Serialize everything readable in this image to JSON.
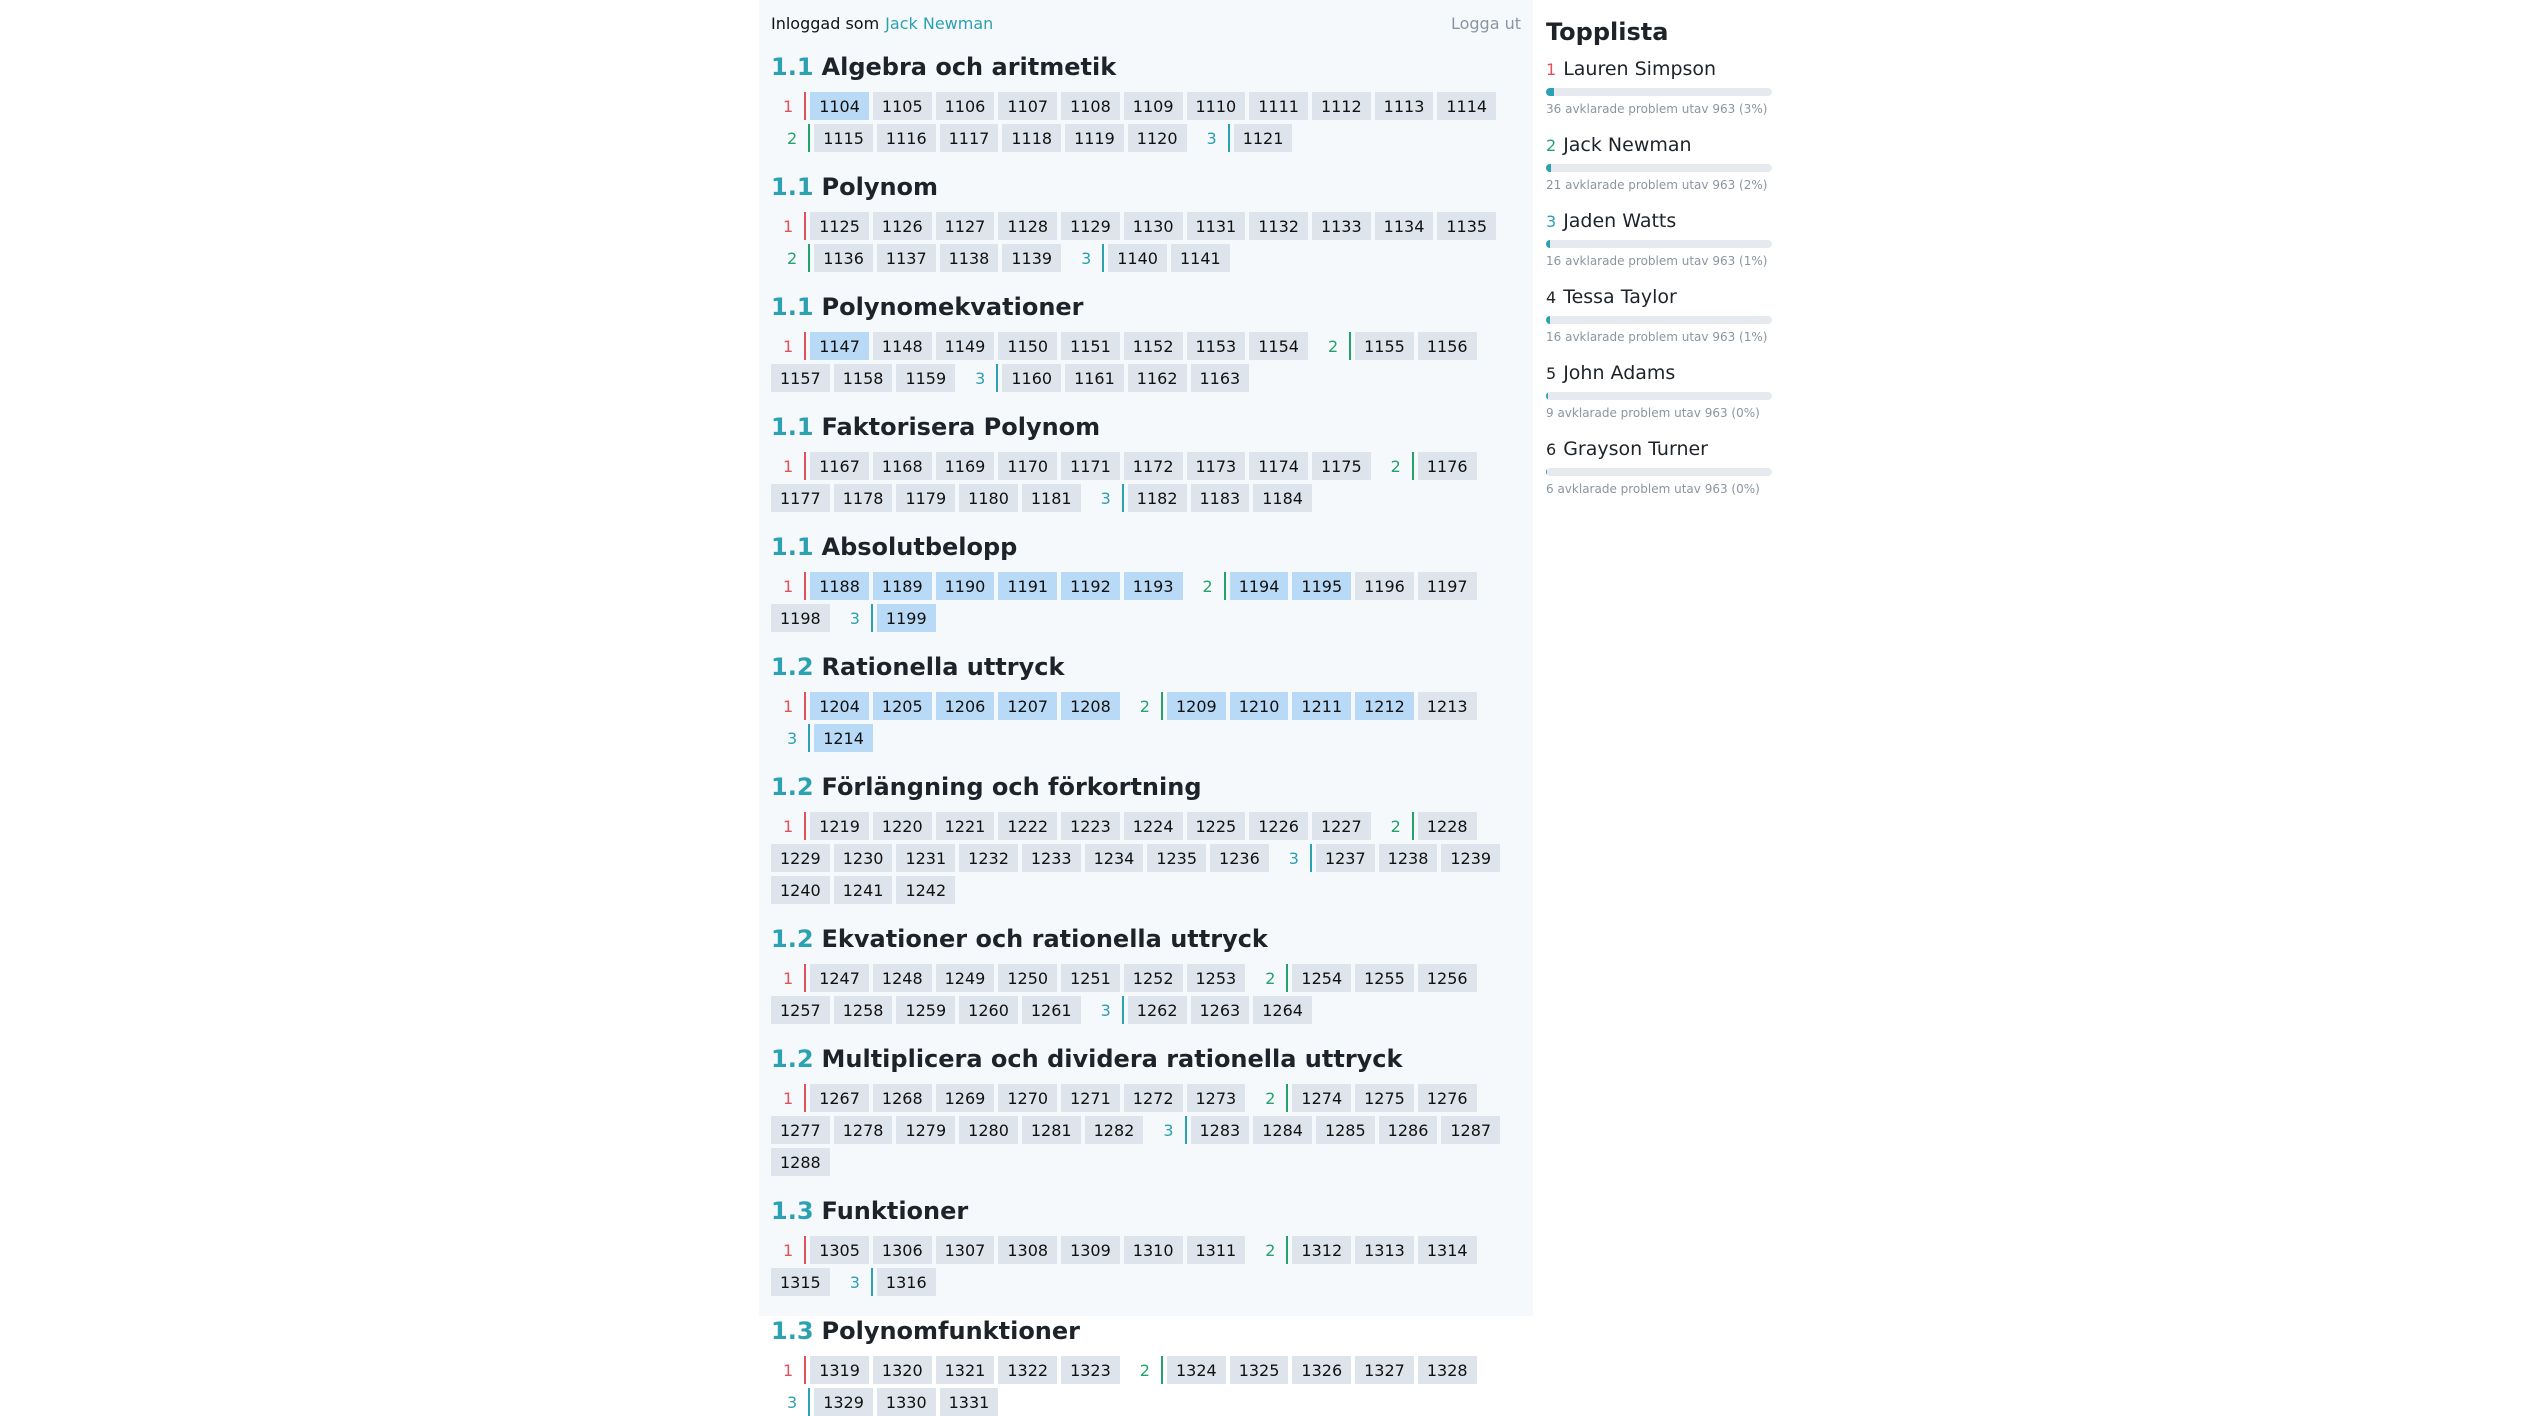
{
  "header": {
    "logged_in_label": "Inloggad som",
    "user_name": "Jack Newman",
    "logout_label": "Logga ut"
  },
  "sections": [
    {
      "number": "1.1",
      "title": "Algebra och aritmetik",
      "levels": [
        {
          "label": "1",
          "problems": [
            {
              "id": "1104",
              "done": true
            },
            {
              "id": "1105"
            },
            {
              "id": "1106"
            },
            {
              "id": "1107"
            },
            {
              "id": "1108"
            },
            {
              "id": "1109"
            },
            {
              "id": "1110"
            },
            {
              "id": "1111"
            },
            {
              "id": "1112"
            },
            {
              "id": "1113"
            },
            {
              "id": "1114"
            }
          ]
        },
        {
          "label": "2",
          "problems": [
            {
              "id": "1115"
            },
            {
              "id": "1116"
            },
            {
              "id": "1117"
            },
            {
              "id": "1118"
            },
            {
              "id": "1119"
            },
            {
              "id": "1120"
            }
          ]
        },
        {
          "label": "3",
          "problems": [
            {
              "id": "1121"
            }
          ]
        }
      ]
    },
    {
      "number": "1.1",
      "title": "Polynom",
      "levels": [
        {
          "label": "1",
          "problems": [
            {
              "id": "1125"
            },
            {
              "id": "1126"
            },
            {
              "id": "1127"
            },
            {
              "id": "1128"
            },
            {
              "id": "1129"
            },
            {
              "id": "1130"
            },
            {
              "id": "1131"
            },
            {
              "id": "1132"
            },
            {
              "id": "1133"
            },
            {
              "id": "1134"
            },
            {
              "id": "1135"
            }
          ]
        },
        {
          "label": "2",
          "problems": [
            {
              "id": "1136"
            },
            {
              "id": "1137"
            },
            {
              "id": "1138"
            },
            {
              "id": "1139"
            }
          ]
        },
        {
          "label": "3",
          "problems": [
            {
              "id": "1140"
            },
            {
              "id": "1141"
            }
          ]
        }
      ]
    },
    {
      "number": "1.1",
      "title": "Polynomekvationer",
      "levels": [
        {
          "label": "1",
          "problems": [
            {
              "id": "1147",
              "done": true
            },
            {
              "id": "1148"
            },
            {
              "id": "1149"
            },
            {
              "id": "1150"
            },
            {
              "id": "1151"
            },
            {
              "id": "1152"
            },
            {
              "id": "1153"
            },
            {
              "id": "1154"
            }
          ]
        },
        {
          "label": "2",
          "problems": [
            {
              "id": "1155"
            },
            {
              "id": "1156"
            },
            {
              "id": "1157"
            },
            {
              "id": "1158"
            },
            {
              "id": "1159"
            }
          ]
        },
        {
          "label": "3",
          "problems": [
            {
              "id": "1160"
            },
            {
              "id": "1161"
            },
            {
              "id": "1162"
            },
            {
              "id": "1163"
            }
          ]
        }
      ]
    },
    {
      "number": "1.1",
      "title": "Faktorisera Polynom",
      "levels": [
        {
          "label": "1",
          "problems": [
            {
              "id": "1167"
            },
            {
              "id": "1168"
            },
            {
              "id": "1169"
            },
            {
              "id": "1170"
            },
            {
              "id": "1171"
            },
            {
              "id": "1172"
            },
            {
              "id": "1173"
            },
            {
              "id": "1174"
            },
            {
              "id": "1175"
            }
          ]
        },
        {
          "label": "2",
          "problems": [
            {
              "id": "1176"
            },
            {
              "id": "1177"
            },
            {
              "id": "1178"
            },
            {
              "id": "1179"
            },
            {
              "id": "1180"
            },
            {
              "id": "1181"
            }
          ]
        },
        {
          "label": "3",
          "problems": [
            {
              "id": "1182"
            },
            {
              "id": "1183"
            },
            {
              "id": "1184"
            }
          ]
        }
      ]
    },
    {
      "number": "1.1",
      "title": "Absolutbelopp",
      "levels": [
        {
          "label": "1",
          "problems": [
            {
              "id": "1188",
              "done": true
            },
            {
              "id": "1189",
              "done": true
            },
            {
              "id": "1190",
              "done": true
            },
            {
              "id": "1191",
              "done": true
            },
            {
              "id": "1192",
              "done": true
            },
            {
              "id": "1193",
              "done": true
            }
          ]
        },
        {
          "label": "2",
          "problems": [
            {
              "id": "1194",
              "done": true
            },
            {
              "id": "1195",
              "done": true
            },
            {
              "id": "1196"
            },
            {
              "id": "1197"
            },
            {
              "id": "1198"
            }
          ]
        },
        {
          "label": "3",
          "problems": [
            {
              "id": "1199",
              "done": true
            }
          ]
        }
      ]
    },
    {
      "number": "1.2",
      "title": "Rationella uttryck",
      "levels": [
        {
          "label": "1",
          "problems": [
            {
              "id": "1204",
              "done": true
            },
            {
              "id": "1205",
              "done": true
            },
            {
              "id": "1206",
              "done": true
            },
            {
              "id": "1207",
              "done": true
            },
            {
              "id": "1208",
              "done": true
            }
          ]
        },
        {
          "label": "2",
          "problems": [
            {
              "id": "1209",
              "done": true
            },
            {
              "id": "1210",
              "done": true
            },
            {
              "id": "1211",
              "done": true
            },
            {
              "id": "1212",
              "done": true
            },
            {
              "id": "1213"
            }
          ]
        },
        {
          "label": "3",
          "problems": [
            {
              "id": "1214",
              "done": true
            }
          ]
        }
      ]
    },
    {
      "number": "1.2",
      "title": "Förlängning och förkortning",
      "levels": [
        {
          "label": "1",
          "problems": [
            {
              "id": "1219"
            },
            {
              "id": "1220"
            },
            {
              "id": "1221"
            },
            {
              "id": "1222"
            },
            {
              "id": "1223"
            },
            {
              "id": "1224"
            },
            {
              "id": "1225"
            },
            {
              "id": "1226"
            },
            {
              "id": "1227"
            }
          ]
        },
        {
          "label": "2",
          "problems": [
            {
              "id": "1228"
            },
            {
              "id": "1229"
            },
            {
              "id": "1230"
            },
            {
              "id": "1231"
            },
            {
              "id": "1232"
            },
            {
              "id": "1233"
            },
            {
              "id": "1234"
            },
            {
              "id": "1235"
            },
            {
              "id": "1236"
            }
          ]
        },
        {
          "label": "3",
          "problems": [
            {
              "id": "1237"
            },
            {
              "id": "1238"
            },
            {
              "id": "1239"
            },
            {
              "id": "1240"
            },
            {
              "id": "1241"
            },
            {
              "id": "1242"
            }
          ]
        }
      ]
    },
    {
      "number": "1.2",
      "title": "Ekvationer och rationella uttryck",
      "levels": [
        {
          "label": "1",
          "problems": [
            {
              "id": "1247"
            },
            {
              "id": "1248"
            },
            {
              "id": "1249"
            },
            {
              "id": "1250"
            },
            {
              "id": "1251"
            },
            {
              "id": "1252"
            },
            {
              "id": "1253"
            }
          ]
        },
        {
          "label": "2",
          "problems": [
            {
              "id": "1254"
            },
            {
              "id": "1255"
            },
            {
              "id": "1256"
            },
            {
              "id": "1257"
            },
            {
              "id": "1258"
            },
            {
              "id": "1259"
            },
            {
              "id": "1260"
            },
            {
              "id": "1261"
            }
          ]
        },
        {
          "label": "3",
          "problems": [
            {
              "id": "1262"
            },
            {
              "id": "1263"
            },
            {
              "id": "1264"
            }
          ]
        }
      ]
    },
    {
      "number": "1.2",
      "title": "Multiplicera och dividera rationella uttryck",
      "levels": [
        {
          "label": "1",
          "problems": [
            {
              "id": "1267"
            },
            {
              "id": "1268"
            },
            {
              "id": "1269"
            },
            {
              "id": "1270"
            },
            {
              "id": "1271"
            },
            {
              "id": "1272"
            },
            {
              "id": "1273"
            }
          ]
        },
        {
          "label": "2",
          "problems": [
            {
              "id": "1274"
            },
            {
              "id": "1275"
            },
            {
              "id": "1276"
            },
            {
              "id": "1277"
            },
            {
              "id": "1278"
            },
            {
              "id": "1279"
            },
            {
              "id": "1280"
            },
            {
              "id": "1281"
            },
            {
              "id": "1282"
            }
          ]
        },
        {
          "label": "3",
          "problems": [
            {
              "id": "1283"
            },
            {
              "id": "1284"
            },
            {
              "id": "1285"
            },
            {
              "id": "1286"
            },
            {
              "id": "1287"
            },
            {
              "id": "1288"
            }
          ]
        }
      ]
    },
    {
      "number": "1.3",
      "title": "Funktioner",
      "levels": [
        {
          "label": "1",
          "problems": [
            {
              "id": "1305"
            },
            {
              "id": "1306"
            },
            {
              "id": "1307"
            },
            {
              "id": "1308"
            },
            {
              "id": "1309"
            },
            {
              "id": "1310"
            },
            {
              "id": "1311"
            }
          ]
        },
        {
          "label": "2",
          "problems": [
            {
              "id": "1312"
            },
            {
              "id": "1313"
            },
            {
              "id": "1314"
            },
            {
              "id": "1315"
            }
          ]
        },
        {
          "label": "3",
          "problems": [
            {
              "id": "1316"
            }
          ]
        }
      ]
    },
    {
      "number": "1.3",
      "title": "Polynomfunktioner",
      "levels": [
        {
          "label": "1",
          "problems": [
            {
              "id": "1319"
            },
            {
              "id": "1320"
            },
            {
              "id": "1321"
            },
            {
              "id": "1322"
            },
            {
              "id": "1323"
            }
          ]
        },
        {
          "label": "2",
          "problems": [
            {
              "id": "1324"
            },
            {
              "id": "1325"
            },
            {
              "id": "1326"
            },
            {
              "id": "1327"
            },
            {
              "id": "1328"
            }
          ]
        },
        {
          "label": "3",
          "problems": [
            {
              "id": "1329"
            },
            {
              "id": "1330"
            },
            {
              "id": "1331"
            }
          ]
        }
      ]
    }
  ],
  "leaderboard": {
    "title": "Topplista",
    "entries": [
      {
        "rank": "1",
        "name": "Lauren Simpson",
        "progress": 0.037,
        "stats": "36 avklarade problem utav 963 (3%)"
      },
      {
        "rank": "2",
        "name": "Jack Newman",
        "progress": 0.022,
        "stats": "21 avklarade problem utav 963 (2%)"
      },
      {
        "rank": "3",
        "name": "Jaden Watts",
        "progress": 0.017,
        "stats": "16 avklarade problem utav 963 (1%)"
      },
      {
        "rank": "4",
        "name": "Tessa Taylor",
        "progress": 0.017,
        "stats": "16 avklarade problem utav 963 (1%)"
      },
      {
        "rank": "5",
        "name": "John Adams",
        "progress": 0.009,
        "stats": "9 avklarade problem utav 963 (0%)"
      },
      {
        "rank": "6",
        "name": "Grayson Turner",
        "progress": 0.006,
        "stats": "6 avklarade problem utav 963 (0%)"
      }
    ]
  }
}
